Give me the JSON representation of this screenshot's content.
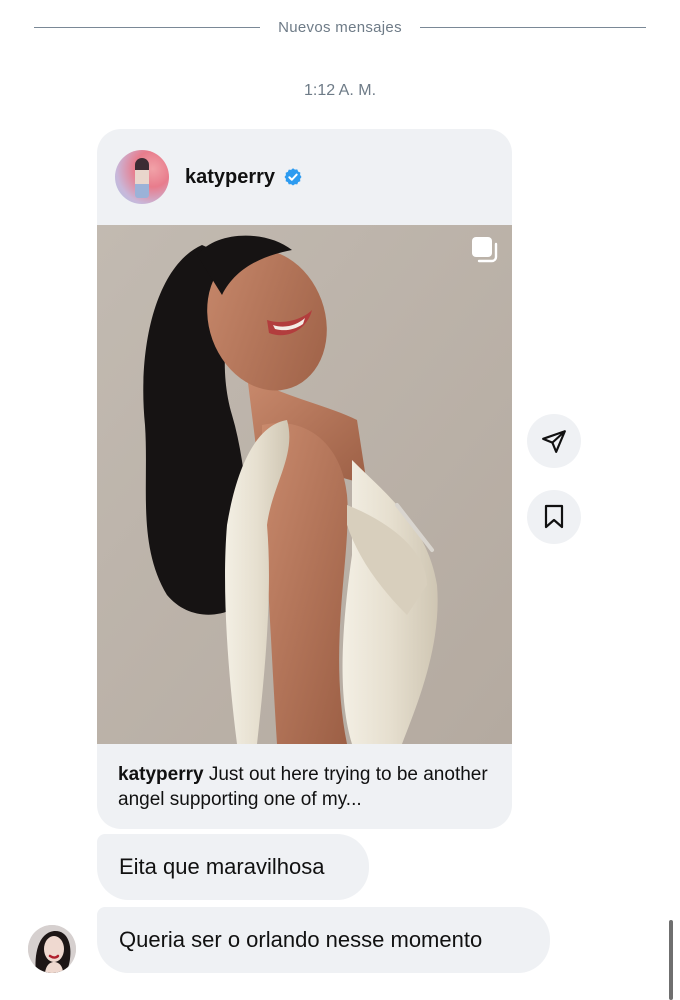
{
  "divider": {
    "label": "Nuevos mensajes"
  },
  "timestamp": "1:12 A. M.",
  "post": {
    "username": "katyperry",
    "verified": true,
    "has_carousel": true,
    "caption_user": "katyperry",
    "caption_text": " Just out here trying to be another angel supporting one of my..."
  },
  "actions": {
    "share_icon": "paper-plane-icon",
    "save_icon": "bookmark-icon"
  },
  "messages": [
    {
      "text": "Eita que maravilhosa"
    },
    {
      "text": "Queria ser o orlando nesse momento"
    }
  ],
  "colors": {
    "bubble_bg": "#eff1f4",
    "verified_blue": "#2d9bf0",
    "muted_text": "#6e7b87"
  }
}
